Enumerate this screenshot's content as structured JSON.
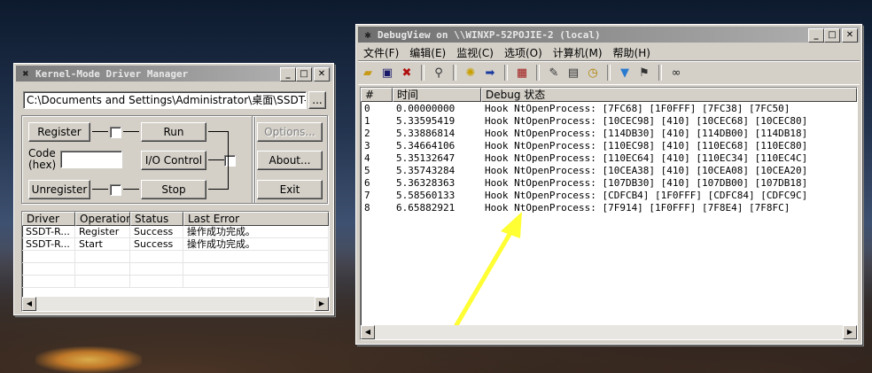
{
  "desktop": {
    "arrow_color": "#ffff33"
  },
  "kmdm": {
    "title": "Kernel-Mode Driver Manager",
    "path_value": "C:\\Documents and Settings\\Administrator\\桌面\\SSDT-RoutineHo",
    "browse_label": "...",
    "register_label": "Register",
    "run_label": "Run",
    "code_label_1": "Code",
    "code_label_2": "(hex)",
    "code_value": "",
    "io_control_label": "I/O Control",
    "unregister_label": "Unregister",
    "stop_label": "Stop",
    "options_label": "Options...",
    "about_label": "About...",
    "exit_label": "Exit",
    "columns": [
      "Driver",
      "Operation",
      "Status",
      "Last Error"
    ],
    "rows": [
      [
        "SSDT-R...",
        "Register",
        "Success",
        "操作成功完成。"
      ],
      [
        "SSDT-R...",
        "Start",
        "Success",
        "操作成功完成。"
      ]
    ]
  },
  "debugview": {
    "title": "DebugView on \\\\WINXP-52POJIE-2 (local)",
    "menu": [
      "文件(F)",
      "编辑(E)",
      "监视(C)",
      "选项(O)",
      "计算机(M)",
      "帮助(H)"
    ],
    "columns": [
      "#",
      "时间",
      "Debug 状态"
    ],
    "rows": [
      [
        "0",
        "0.00000000",
        "Hook NtOpenProcess: [7FC68] [1F0FFF] [7FC38] [7FC50]"
      ],
      [
        "1",
        "5.33595419",
        "Hook NtOpenProcess: [10CEC98] [410] [10CEC68] [10CEC80]"
      ],
      [
        "2",
        "5.33886814",
        "Hook NtOpenProcess: [114DB30] [410] [114DB00] [114DB18]"
      ],
      [
        "3",
        "5.34664106",
        "Hook NtOpenProcess: [110EC98] [410] [110EC68] [110EC80]"
      ],
      [
        "4",
        "5.35132647",
        "Hook NtOpenProcess: [110EC64] [410] [110EC34] [110EC4C]"
      ],
      [
        "5",
        "5.35743284",
        "Hook NtOpenProcess: [10CEA38] [410] [10CEA08] [10CEA20]"
      ],
      [
        "6",
        "5.36328363",
        "Hook NtOpenProcess: [107DB30] [410] [107DB00] [107DB18]"
      ],
      [
        "7",
        "5.58560133",
        "Hook NtOpenProcess: [CDFCB4] [1F0FFF] [CDFC84] [CDFC9C]"
      ],
      [
        "8",
        "6.65882921",
        "Hook NtOpenProcess: [7F914] [1F0FFF] [7F8E4] [7F8FC]"
      ]
    ]
  }
}
